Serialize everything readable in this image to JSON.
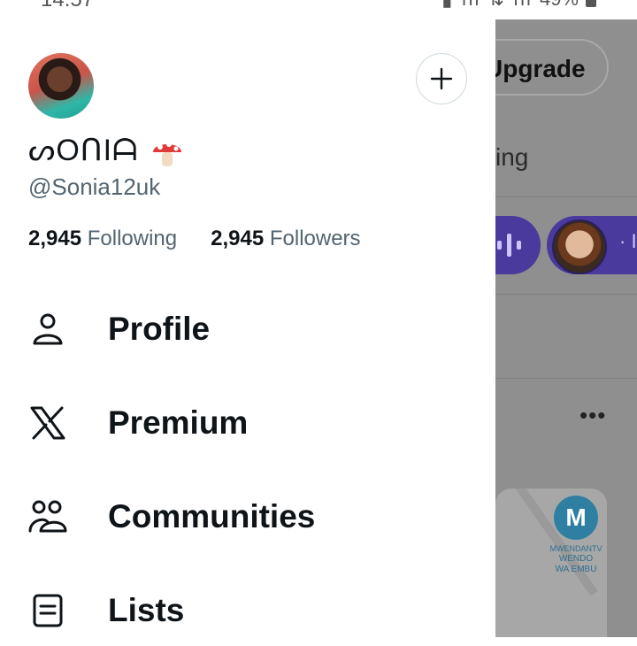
{
  "status_bar": {
    "time": "14:57",
    "battery": "49%"
  },
  "drawer": {
    "display_name": "ᔕOᑎIᗩ",
    "handle": "@Sonia12uk",
    "following_count": "2,945",
    "following_label": "Following",
    "followers_count": "2,945",
    "followers_label": "Followers",
    "menu": [
      {
        "label": "Profile",
        "icon": "person-icon"
      },
      {
        "label": "Premium",
        "icon": "x-logo-icon"
      },
      {
        "label": "Communities",
        "icon": "communities-icon"
      },
      {
        "label": "Lists",
        "icon": "lists-icon"
      }
    ]
  },
  "background_feed": {
    "upgrade_label": "Upgrade",
    "tab_fragment": "ing",
    "media_text_1": "MWENDANTV",
    "media_text_2": "WENDO",
    "media_text_3": "WA EMBU",
    "media_logo": "M"
  },
  "colors": {
    "text_primary": "#0f1419",
    "text_secondary": "#536471",
    "spaces_purple": "#4a3a9d"
  }
}
